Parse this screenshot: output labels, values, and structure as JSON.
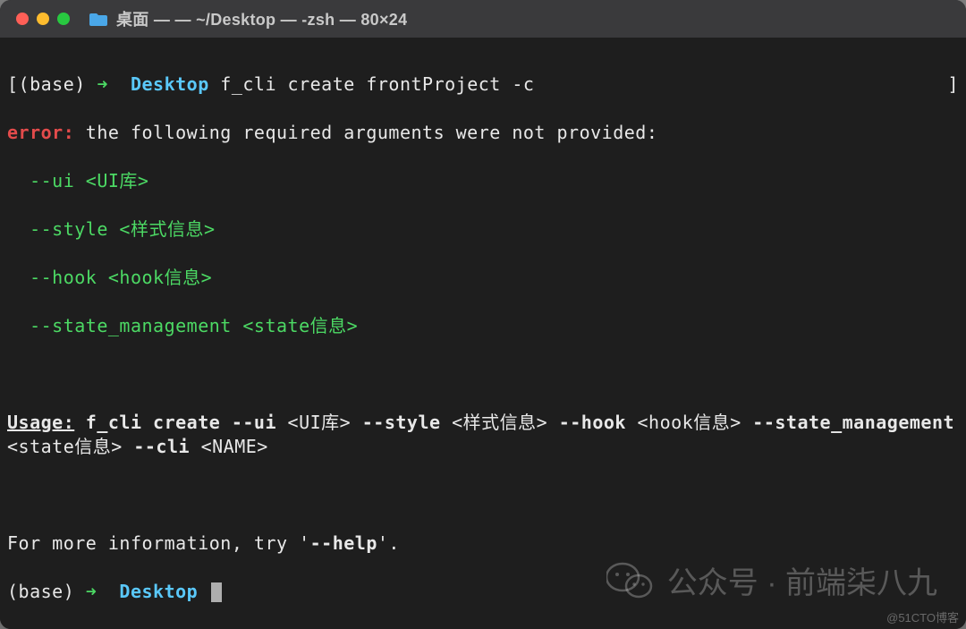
{
  "window": {
    "title": "桌面 —                          — ~/Desktop — -zsh — 80×24"
  },
  "terminal": {
    "line1": {
      "open": "[",
      "env": "(base)",
      "arrow": " ➜  ",
      "dir": "Desktop",
      "cmd": " f_cli create frontProject -c",
      "close_br": "]"
    },
    "line2": {
      "label": "error:",
      "msg": " the following required arguments were not provided:"
    },
    "arg1": "  --ui <UI库>",
    "arg2": "  --style <样式信息>",
    "arg3": "  --hook <hook信息>",
    "arg4": "  --state_management <state信息>",
    "usage_label": "Usage:",
    "usage_text1": " f_cli create --ui ",
    "usage_ph1": "<UI库>",
    "usage_text2": " --style ",
    "usage_ph2": "<样式信息>",
    "usage_text3": " --hook ",
    "usage_ph3": "<hook信息>",
    "usage_text4": " --state_management ",
    "usage_ph4": "<state信息>",
    "usage_text5": " --cli ",
    "usage_ph5": "<NAME>",
    "more_info_pre": "For more information, try '",
    "more_info_flag": "--help",
    "more_info_post": "'.",
    "line_end": {
      "env": "(base)",
      "arrow": " ➜  ",
      "dir": "Desktop"
    }
  },
  "watermark": "公众号 · 前端柒八九",
  "copyright": "@51CTO博客"
}
